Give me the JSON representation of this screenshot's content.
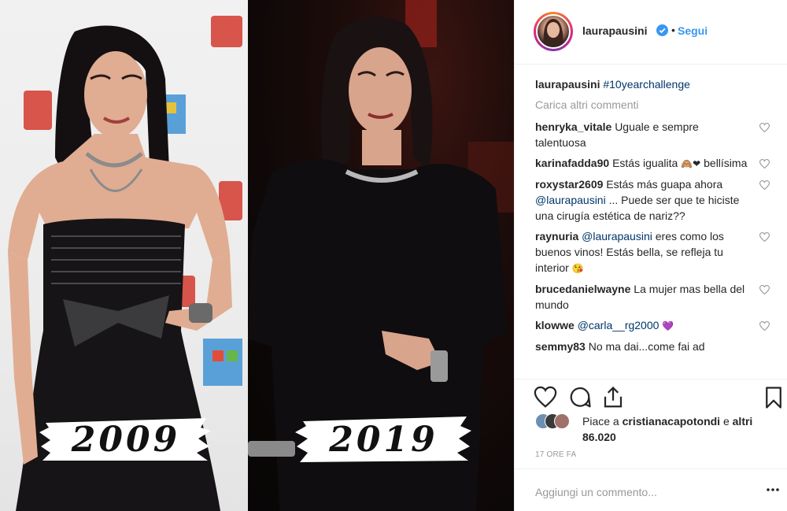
{
  "post": {
    "username": "laurapausini",
    "verified_icon": "verified-badge-icon",
    "separator": "•",
    "follow_label": "Segui",
    "photo_years": [
      "2009",
      "2019"
    ]
  },
  "caption": {
    "username": "laurapausini",
    "hashtag": "#10yearchallenge"
  },
  "load_more_label": "Carica altri commenti",
  "comments": [
    {
      "user": "henryka_vitale",
      "mention": "",
      "text": "Uguale e sempre talentuosa",
      "emoji": ""
    },
    {
      "user": "karinafadda90",
      "mention": "",
      "text": "Estás igualita",
      "emoji": "🙈❤",
      "text2": "bellísima"
    },
    {
      "user": "roxystar2609",
      "mention": "@laurapausini",
      "pre": "Estás más guapa ahora",
      "text": "... Puede ser que te hiciste una cirugía estética de nariz??",
      "emoji": ""
    },
    {
      "user": "raynuria",
      "mention": "@laurapausini",
      "pre": "",
      "text": "eres como los buenos vinos! Estás bella, se refleja tu interior",
      "emoji": "😘"
    },
    {
      "user": "brucedanielwayne",
      "mention": "",
      "text": "La mujer mas bella del mundo",
      "emoji": ""
    },
    {
      "user": "klowwe",
      "mention": "@carla__rg2000",
      "pre": "",
      "text": "",
      "emoji": "💜"
    },
    {
      "user": "semmy83",
      "mention": "",
      "text": "No ma dai...come fai ad",
      "emoji": ""
    }
  ],
  "likes": {
    "prefix": "Piace a",
    "user": "cristianacapotondi",
    "connector": "e",
    "others": "altri 86.020"
  },
  "timestamp": "17 ORE FA",
  "add_comment": {
    "placeholder": "Aggiungi un commento...",
    "more_label": "•••"
  },
  "colors": {
    "link_blue": "#3897f0",
    "mention_blue": "#003569",
    "muted": "#999999",
    "text": "#262626"
  }
}
